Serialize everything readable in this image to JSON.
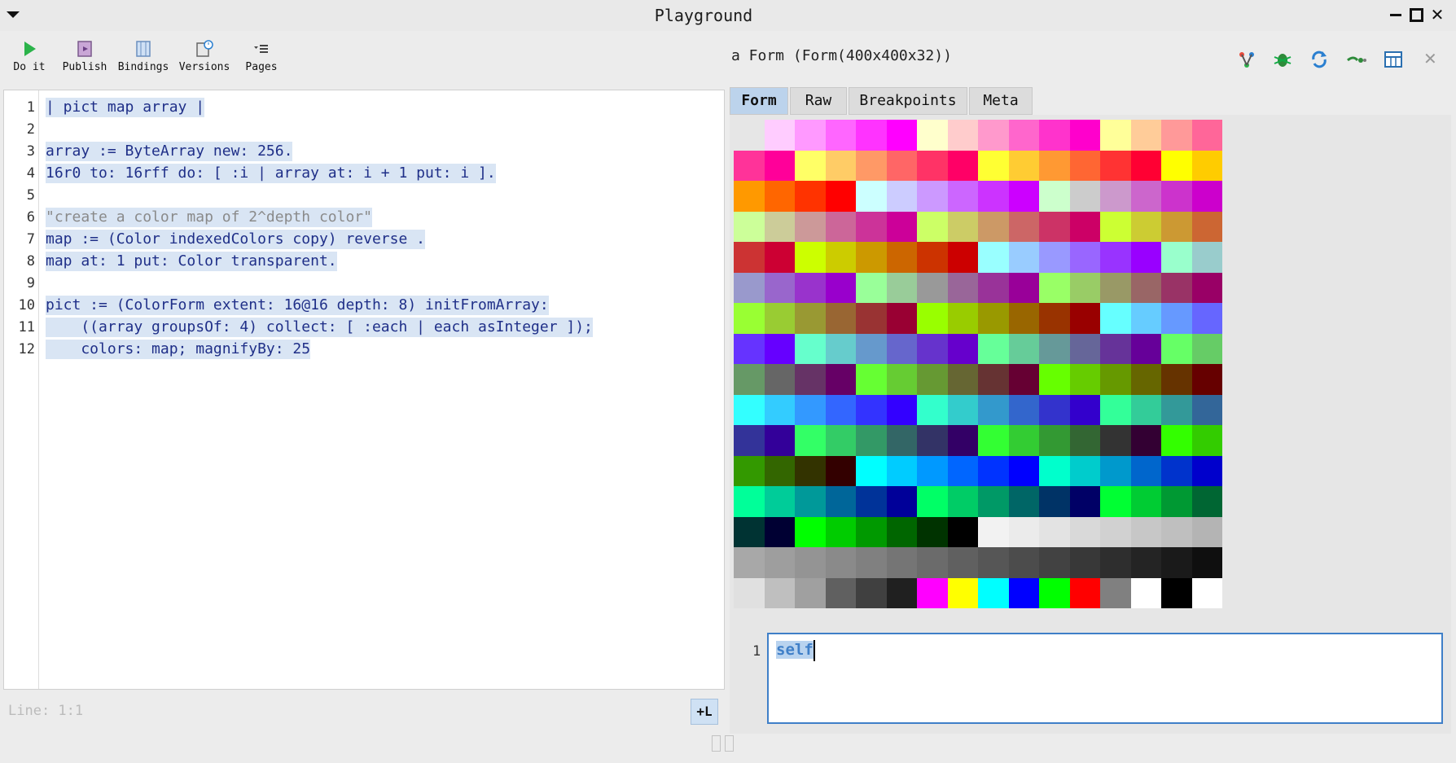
{
  "window": {
    "title": "Playground",
    "controls": [
      "minimize-icon",
      "maximize-icon",
      "close-icon"
    ]
  },
  "toolbar": {
    "do_it": "Do it",
    "publish": "Publish",
    "bindings": "Bindings",
    "versions": "Versions",
    "pages": "Pages"
  },
  "editor": {
    "lines": [
      {
        "n": "1",
        "text": "| pict map array |"
      },
      {
        "n": "2",
        "text": ""
      },
      {
        "n": "3",
        "text": "array := ByteArray new: 256."
      },
      {
        "n": "4",
        "text": "16r0 to: 16rff do: [ :i | array at: i + 1 put: i ]."
      },
      {
        "n": "5",
        "text": ""
      },
      {
        "n": "6",
        "text": "\"create a color map of 2^depth color\""
      },
      {
        "n": "7",
        "text": "map := (Color indexedColors copy) reverse ."
      },
      {
        "n": "8",
        "text": "map at: 1 put: Color transparent."
      },
      {
        "n": "9",
        "text": ""
      },
      {
        "n": "10",
        "text": "pict := (ColorForm extent: 16@16 depth: 8) initFromArray:"
      },
      {
        "n": "11",
        "text": "    ((array groupsOf: 4) collect: [ :each | each asInteger ]);"
      },
      {
        "n": "12",
        "text": "    colors: map; magnifyBy: 25"
      }
    ],
    "status": "Line: 1:1",
    "plus_l": "+L"
  },
  "inspector": {
    "title": "a Form (Form(400x400x32))",
    "icons": [
      "branch-icon",
      "bug-icon",
      "refresh-icon",
      "browse-icon",
      "grid-icon",
      "close-icon"
    ],
    "tabs": [
      "Form",
      "Raw",
      "Breakpoints",
      "Meta"
    ],
    "active_tab": "Form",
    "form_colors": [
      "#e6e6e6",
      "#ffccff",
      "#ff99ff",
      "#ff66ff",
      "#ff33ff",
      "#ff00ff",
      "#ffffcc",
      "#ffcccc",
      "#ff99cc",
      "#ff66cc",
      "#ff33cc",
      "#ff00cc",
      "#ffff99",
      "#ffcc99",
      "#ff9999",
      "#ff6699",
      "#ff3399",
      "#ff0099",
      "#ffff66",
      "#ffcc66",
      "#ff9966",
      "#ff6666",
      "#ff3366",
      "#ff0066",
      "#ffff33",
      "#ffcc33",
      "#ff9933",
      "#ff6633",
      "#ff3333",
      "#ff0033",
      "#ffff00",
      "#ffcc00",
      "#ff9900",
      "#ff6600",
      "#ff3300",
      "#ff0000",
      "#ccffff",
      "#ccccff",
      "#cc99ff",
      "#cc66ff",
      "#cc33ff",
      "#cc00ff",
      "#ccffcc",
      "#cccccc",
      "#cc99cc",
      "#cc66cc",
      "#cc33cc",
      "#cc00cc",
      "#ccff99",
      "#cccc99",
      "#cc9999",
      "#cc6699",
      "#cc3399",
      "#cc0099",
      "#ccff66",
      "#cccc66",
      "#cc9966",
      "#cc6666",
      "#cc3366",
      "#cc0066",
      "#ccff33",
      "#cccc33",
      "#cc9933",
      "#cc6633",
      "#cc3333",
      "#cc0033",
      "#ccff00",
      "#cccc00",
      "#cc9900",
      "#cc6600",
      "#cc3300",
      "#cc0000",
      "#99ffff",
      "#99ccff",
      "#9999ff",
      "#9966ff",
      "#9933ff",
      "#9900ff",
      "#99ffcc",
      "#99cccc",
      "#9999cc",
      "#9966cc",
      "#9933cc",
      "#9900cc",
      "#99ff99",
      "#99cc99",
      "#999999",
      "#996699",
      "#993399",
      "#990099",
      "#99ff66",
      "#99cc66",
      "#999966",
      "#996666",
      "#993366",
      "#990066",
      "#99ff33",
      "#99cc33",
      "#999933",
      "#996633",
      "#993333",
      "#990033",
      "#99ff00",
      "#99cc00",
      "#999900",
      "#996600",
      "#993300",
      "#990000",
      "#66ffff",
      "#66ccff",
      "#6699ff",
      "#6666ff",
      "#6633ff",
      "#6600ff",
      "#66ffcc",
      "#66cccc",
      "#6699cc",
      "#6666cc",
      "#6633cc",
      "#6600cc",
      "#66ff99",
      "#66cc99",
      "#669999",
      "#666699",
      "#663399",
      "#660099",
      "#66ff66",
      "#66cc66",
      "#669966",
      "#666666",
      "#663366",
      "#660066",
      "#66ff33",
      "#66cc33",
      "#669933",
      "#666633",
      "#663333",
      "#660033",
      "#66ff00",
      "#66cc00",
      "#669900",
      "#666600",
      "#663300",
      "#660000",
      "#33ffff",
      "#33ccff",
      "#3399ff",
      "#3366ff",
      "#3333ff",
      "#3300ff",
      "#33ffcc",
      "#33cccc",
      "#3399cc",
      "#3366cc",
      "#3333cc",
      "#3300cc",
      "#33ff99",
      "#33cc99",
      "#339999",
      "#336699",
      "#333399",
      "#330099",
      "#33ff66",
      "#33cc66",
      "#339966",
      "#336666",
      "#333366",
      "#330066",
      "#33ff33",
      "#33cc33",
      "#339933",
      "#336633",
      "#333333",
      "#330033",
      "#33ff00",
      "#33cc00",
      "#339900",
      "#336600",
      "#333300",
      "#330000",
      "#00ffff",
      "#00ccff",
      "#0099ff",
      "#0066ff",
      "#0033ff",
      "#0000ff",
      "#00ffcc",
      "#00cccc",
      "#0099cc",
      "#0066cc",
      "#0033cc",
      "#0000cc",
      "#00ff99",
      "#00cc99",
      "#009999",
      "#006699",
      "#003399",
      "#000099",
      "#00ff66",
      "#00cc66",
      "#009966",
      "#006666",
      "#003366",
      "#000066",
      "#00ff33",
      "#00cc33",
      "#009933",
      "#006633",
      "#003333",
      "#000033",
      "#00ff00",
      "#00cc00",
      "#009900",
      "#006600",
      "#003300",
      "#000000",
      "#f2f2f2",
      "#ebebeb",
      "#e3e3e3",
      "#d9d9d9",
      "#d1d1d1",
      "#c7c7c7",
      "#bfbfbf",
      "#b4b4b4",
      "#a8a8a8",
      "#9e9e9e",
      "#949494",
      "#8a8a8a",
      "#808080",
      "#757575",
      "#6b6b6b",
      "#606060",
      "#565656",
      "#4c4c4c",
      "#424242",
      "#383838",
      "#2e2e2e",
      "#242424",
      "#1a1a1a",
      "#0f0f0f",
      "#e0e0e0",
      "#bfbfbf",
      "#a0a0a0",
      "#606060",
      "#404040",
      "#202020",
      "#ff00ff",
      "#ffff00",
      "#00ffff",
      "#0000ff",
      "#00ff00",
      "#ff0000",
      "#808080",
      "#ffffff",
      "#000000",
      "#ffffff"
    ]
  },
  "evaluator": {
    "line": "1",
    "text": "self"
  }
}
